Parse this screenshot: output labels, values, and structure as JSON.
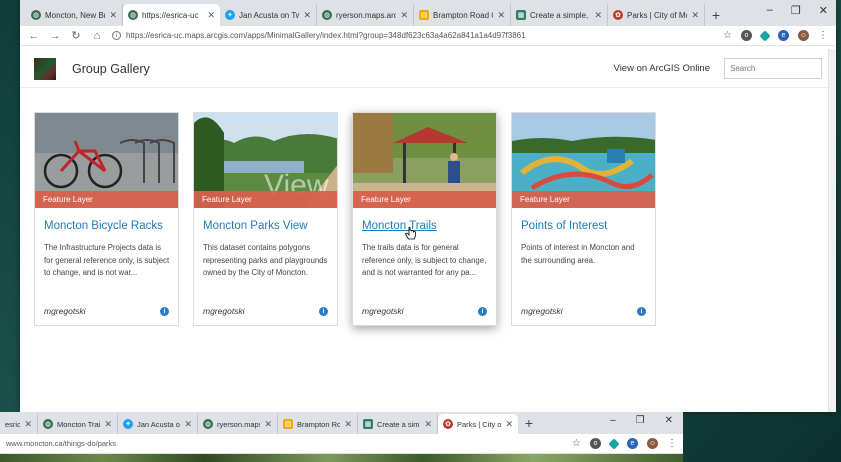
{
  "browser": {
    "tabs": [
      {
        "title": "Moncton, New Br",
        "favicon_color": "#3a6b4f"
      },
      {
        "title": "https://esrica-uc",
        "favicon_color": "#3a6b4f",
        "active": true
      },
      {
        "title": "Jan Acusta on Twi",
        "favicon_color": "#1da1f2"
      },
      {
        "title": "ryerson.maps.arcg",
        "favicon_color": "#3a6b4f"
      },
      {
        "title": "Brampton Road C",
        "favicon_color": "#f2a900"
      },
      {
        "title": "Create a simple, co",
        "favicon_color": "#2a7f62"
      },
      {
        "title": "Parks | City of Mo",
        "favicon_color": "#c0392b"
      }
    ],
    "new_tab": "+",
    "window_controls": {
      "minimize": "–",
      "maximize": "❐",
      "close": "✕"
    },
    "url": "https://esrica-uc.maps.arcgis.com/apps/MinimalGallery/index.html?group=348df623c63a4a62a841a1a4d97f3861"
  },
  "header": {
    "title": "Group Gallery",
    "view_link": "View on ArcGIS Online",
    "search_placeholder": "Search"
  },
  "cards": [
    {
      "badge": "Feature Layer",
      "title": "Moncton Bicycle Racks",
      "description": "The Infrastructure Projects data is for general reference only, is subject to change, and is not war...",
      "owner": "mgregotski"
    },
    {
      "badge": "Feature Layer",
      "title": "Moncton Parks View",
      "description": "This dataset contains polygons representing parks and playgrounds owned by the City of Moncton.",
      "owner": "mgregotski"
    },
    {
      "badge": "Feature Layer",
      "title": "Moncton Trails",
      "description": "The trails data is for general reference only, is subject to change, and is not warranted for any pa...",
      "owner": "mgregotski"
    },
    {
      "badge": "Feature Layer",
      "title": "Points of Interest",
      "description": "Points of interest in Moncton and the surrounding area.",
      "owner": "mgregotski"
    }
  ],
  "browser2": {
    "tabs": [
      {
        "title": "esrica-",
        "favicon_color": "#3a6b4f"
      },
      {
        "title": "Moncton Trails",
        "favicon_color": "#3a6b4f"
      },
      {
        "title": "Jan Acusta on",
        "favicon_color": "#1da1f2"
      },
      {
        "title": "ryerson.maps",
        "favicon_color": "#3a6b4f"
      },
      {
        "title": "Brampton Ro",
        "favicon_color": "#f2a900"
      },
      {
        "title": "Create a simp",
        "favicon_color": "#2a7f62"
      },
      {
        "title": "Parks | City of",
        "favicon_color": "#c0392b",
        "active": true
      }
    ],
    "url": "www.moncton.ca/things-do/parks"
  }
}
